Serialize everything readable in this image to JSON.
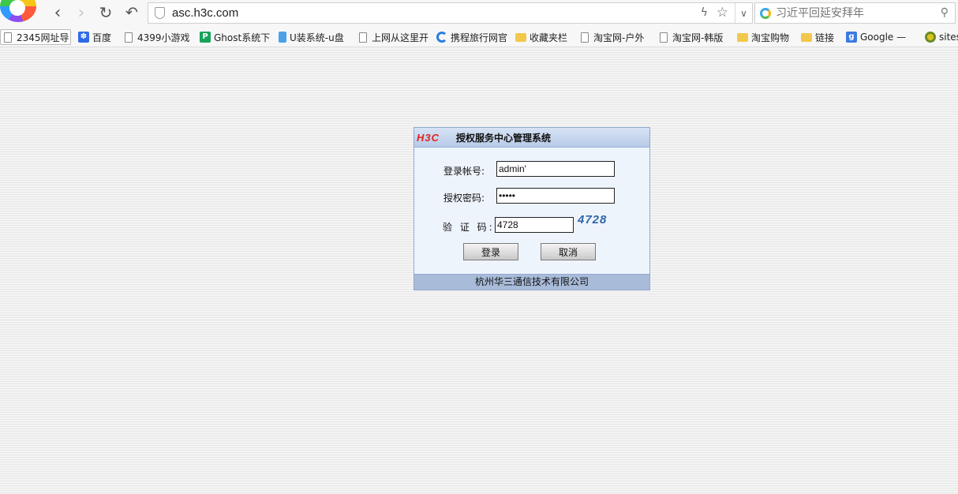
{
  "browser": {
    "url": "asc.h3c.com",
    "search_placeholder": "习近平回延安拜年",
    "icons": {
      "back": "chevron-left-icon",
      "forward": "chevron-right-icon",
      "reload": "reload-icon",
      "undo": "undo-icon",
      "site_security": "shield-icon",
      "speed": "bolt-icon",
      "favorite": "star-icon",
      "dropdown": "chevron-down-icon",
      "search": "search-icon"
    }
  },
  "bookmarks": [
    {
      "label": "2345网址导",
      "icon": "page-icon"
    },
    {
      "label": "百度",
      "icon": "baidu-icon"
    },
    {
      "label": "4399小游戏",
      "icon": "page-icon"
    },
    {
      "label": "Ghost系统下",
      "icon": "ghost-icon"
    },
    {
      "label": "U装系统-u盘",
      "icon": "usys-icon"
    },
    {
      "label": "上网从这里开",
      "icon": "page-icon"
    },
    {
      "label": "携程旅行网官",
      "icon": "ctrip-icon"
    },
    {
      "label": "收藏夹栏",
      "icon": "folder-icon"
    },
    {
      "label": "淘宝网-户外",
      "icon": "page-icon"
    },
    {
      "label": "淘宝网-韩版",
      "icon": "page-icon"
    },
    {
      "label": "淘宝购物",
      "icon": "folder-icon"
    },
    {
      "label": "链接",
      "icon": "folder-icon"
    },
    {
      "label": "Google —",
      "icon": "google-icon"
    },
    {
      "label": "sites",
      "icon": "sites-icon"
    }
  ],
  "login": {
    "logo_text": "H3C",
    "title": "授权服务中心管理系统",
    "account_label": "登录帐号:",
    "account_value": "admin'",
    "password_label": "授权密码:",
    "password_value": "•••••",
    "captcha_label": "验 证 码:",
    "captcha_value": "4728",
    "captcha_image_text": "4728",
    "login_button": "登录",
    "cancel_button": "取消",
    "footer": "杭州华三通信技术有限公司"
  },
  "colors": {
    "panel_border": "#8fa8cf",
    "panel_header": "#b8cbe8",
    "panel_footer": "#a8bbd9",
    "h3c_red": "#e0241b",
    "captcha_blue": "#2f67a8"
  }
}
